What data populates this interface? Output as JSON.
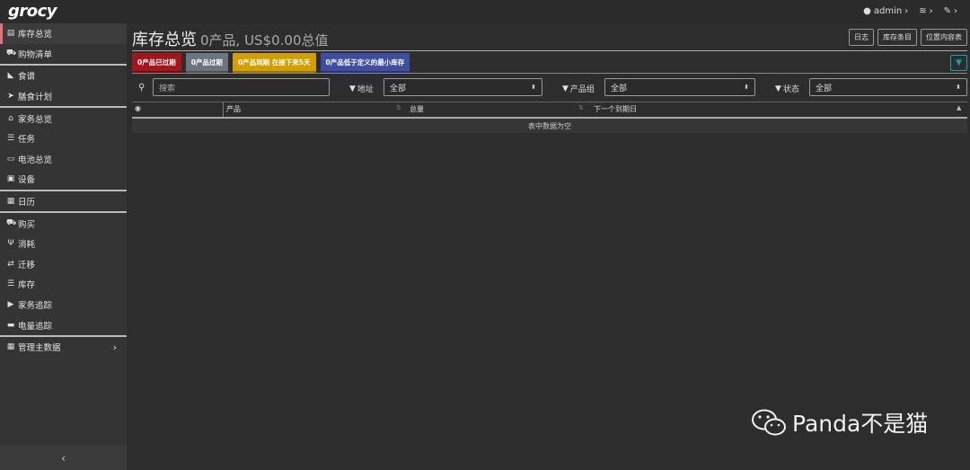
{
  "app": {
    "logo": "grocy"
  },
  "topbar": {
    "user": "admin",
    "user_icon": "user-icon",
    "settings_icon": "sliders-icon",
    "tools_icon": "wrench-icon"
  },
  "sidebar": {
    "items": [
      {
        "label": "库存总览",
        "icon": "box-icon",
        "glyph": "▤"
      },
      {
        "label": "购物清单",
        "icon": "cart-icon",
        "glyph": "⛟"
      },
      {
        "label": "食谱",
        "icon": "pizza-icon",
        "glyph": "◣"
      },
      {
        "label": "膳食计划",
        "icon": "paper-plane-icon",
        "glyph": "➤"
      },
      {
        "label": "家务总览",
        "icon": "home-icon",
        "glyph": "⌂"
      },
      {
        "label": "任务",
        "icon": "tasks-icon",
        "glyph": "☰"
      },
      {
        "label": "电池总览",
        "icon": "battery-icon",
        "glyph": "▭"
      },
      {
        "label": "设备",
        "icon": "toolbox-icon",
        "glyph": "▣"
      },
      {
        "label": "日历",
        "icon": "calendar-icon",
        "glyph": "▦"
      },
      {
        "label": "购买",
        "icon": "cart-icon",
        "glyph": "⛟"
      },
      {
        "label": "消耗",
        "icon": "utensils-icon",
        "glyph": "Ψ"
      },
      {
        "label": "迁移",
        "icon": "exchange-icon",
        "glyph": "⇄"
      },
      {
        "label": "库存",
        "icon": "list-icon",
        "glyph": "☰"
      },
      {
        "label": "家务追踪",
        "icon": "play-icon",
        "glyph": "▶"
      },
      {
        "label": "电量追踪",
        "icon": "car-battery-icon",
        "glyph": "▬"
      },
      {
        "label": "管理主数据",
        "icon": "table-icon",
        "glyph": "▦"
      }
    ],
    "collapse_glyph": "‹"
  },
  "main": {
    "title": "库存总览",
    "subtitle": "0产品, US$0.00总值",
    "buttons": [
      "日志",
      "库存条目",
      "位置内容表"
    ],
    "badges": [
      "0产品已过期",
      "0产品过期",
      "0产品到期 在接下来5天",
      "0产品低于定义的最小库存"
    ],
    "search_placeholder": "搜索",
    "filters": [
      {
        "label": "地址",
        "value": "全部"
      },
      {
        "label": "产品组",
        "value": "全部"
      },
      {
        "label": "状态",
        "value": "全部"
      }
    ],
    "table": {
      "columns": [
        "产品",
        "总量",
        "下一个到期日"
      ],
      "empty_text": "表中数据为空"
    }
  },
  "watermark": {
    "text": "Panda不是猫"
  }
}
